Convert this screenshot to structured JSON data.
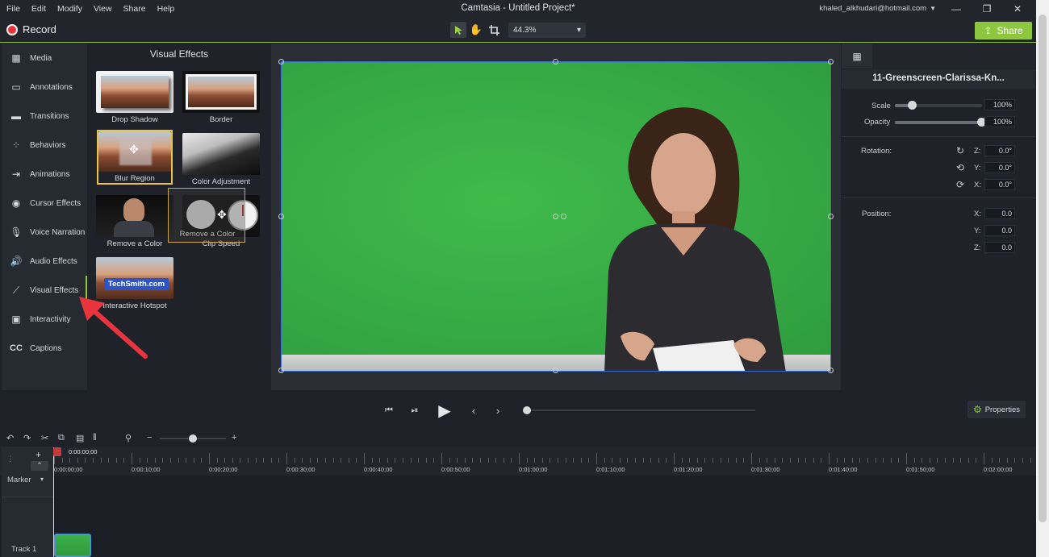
{
  "window": {
    "title": "Camtasia - Untitled Project*",
    "account": "khaled_alkhudari@hotmail.com",
    "menu": [
      "File",
      "Edit",
      "Modify",
      "View",
      "Share",
      "Help"
    ]
  },
  "toolbar": {
    "record_label": "Record",
    "zoom_value": "44.3%",
    "share_label": "Share"
  },
  "sidebar": {
    "items": [
      {
        "label": "Media",
        "icon": "media-icon"
      },
      {
        "label": "Annotations",
        "icon": "annotations-icon"
      },
      {
        "label": "Transitions",
        "icon": "transitions-icon"
      },
      {
        "label": "Behaviors",
        "icon": "behaviors-icon"
      },
      {
        "label": "Animations",
        "icon": "animations-icon"
      },
      {
        "label": "Cursor Effects",
        "icon": "cursor-icon"
      },
      {
        "label": "Voice Narration",
        "icon": "microphone-icon"
      },
      {
        "label": "Audio Effects",
        "icon": "speaker-icon"
      },
      {
        "label": "Visual Effects",
        "icon": "wand-icon"
      },
      {
        "label": "Interactivity",
        "icon": "interactivity-icon"
      },
      {
        "label": "Captions",
        "icon": "captions-icon"
      }
    ],
    "active": "Visual Effects"
  },
  "effects_panel": {
    "title": "Visual Effects",
    "tiles": [
      "Drop Shadow",
      "Border",
      "Blur Region",
      "Color Adjustment",
      "Remove a Color",
      "Clip Speed",
      "Interactive Hotspot"
    ],
    "hotspot_badge": "TechSmith.com",
    "drag_ghost_label": "Remove a Color"
  },
  "properties": {
    "clip_name": "11-Greenscreen-Clarissa-Kn...",
    "scale_label": "Scale",
    "scale_value": "100%",
    "scale_level": 0.2,
    "opacity_label": "Opacity",
    "opacity_value": "100%",
    "opacity_level": 1.0,
    "rotation_label": "Rotation:",
    "rotation": [
      {
        "axis": "Z:",
        "value": "0.0°"
      },
      {
        "axis": "Y:",
        "value": "0.0°"
      },
      {
        "axis": "X:",
        "value": "0.0°"
      }
    ],
    "position_label": "Position:",
    "position": [
      {
        "axis": "X:",
        "value": "0.0"
      },
      {
        "axis": "Y:",
        "value": "0.0"
      },
      {
        "axis": "Z:",
        "value": "0.0"
      }
    ],
    "properties_button": "Properties"
  },
  "timeline": {
    "current_time": "0:00:00;00",
    "marker_label": "Marker",
    "track_label": "Track 1",
    "ticks": [
      "0:00:00;00",
      "0:00:10;00",
      "0:00:20;00",
      "0:00:30;00",
      "0:00:40;00",
      "0:00:50;00",
      "0:01:00;00",
      "0:01:10;00",
      "0:01:20;00",
      "0:01:30;00",
      "0:01:40;00",
      "0:01:50;00",
      "0:02:00;00"
    ]
  },
  "colors": {
    "accent": "#8ec63f",
    "record": "#e8353d",
    "selection": "#3c6bd6",
    "arrow": "#e8353d"
  }
}
